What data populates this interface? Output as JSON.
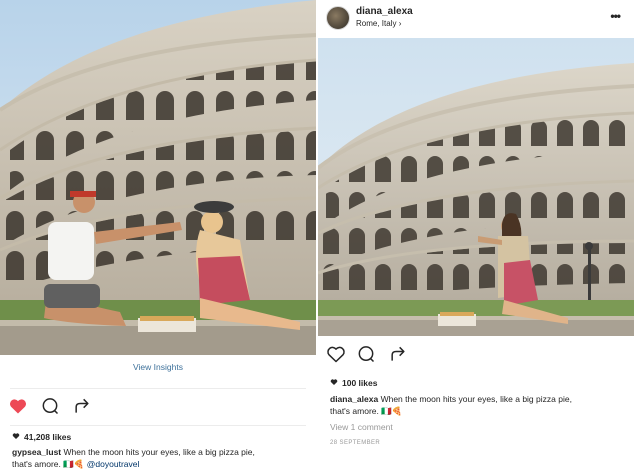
{
  "left_post": {
    "view_insights": "View Insights",
    "likes": "41,208 likes",
    "username": "gypsea_lust",
    "caption": "When the moon hits your eyes, like a big pizza pie,",
    "caption_line2": "that's amore.",
    "caption_emoji": "🇮🇹🍕",
    "mention": "@doyoutravel",
    "liked": true,
    "like_color": "#ed4956"
  },
  "right_post": {
    "username": "diana_alexa",
    "location": "Rome, Italy",
    "location_chevron": "›",
    "more": "•••",
    "likes": "100 likes",
    "caption_username": "diana_alexa",
    "caption": "When the moon hits your eyes, like a big pizza pie,",
    "caption_line2": "that's amore.",
    "caption_emoji": "🇮🇹🍕",
    "view_comments": "View 1 comment",
    "date": "28 SEPTEMBER"
  },
  "icons": {
    "heart": "heart-icon",
    "comment": "comment-icon",
    "share": "share-icon",
    "more": "more-icon"
  }
}
